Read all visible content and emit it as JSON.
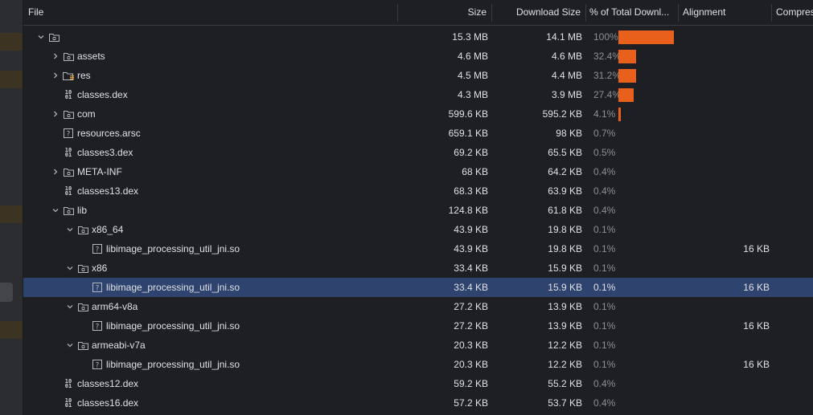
{
  "columns": {
    "file": "File",
    "size": "Size",
    "download_size": "Download Size",
    "percent": "% of Total Downl...",
    "alignment": "Alignment",
    "compression": "Compres"
  },
  "colors": {
    "accent_bar": "#e8601c",
    "selection": "#2e436e",
    "background": "#1e1f22"
  },
  "rows": [
    {
      "name": "",
      "icon": "folder-icon",
      "depth": 0,
      "chevron": "down",
      "size": "15.3 MB",
      "download": "14.1 MB",
      "percent": "100%",
      "fraction": 1.0,
      "alignment": ""
    },
    {
      "name": "assets",
      "icon": "folder-icon",
      "depth": 1,
      "chevron": "right",
      "size": "4.6 MB",
      "download": "4.6 MB",
      "percent": "32.4%",
      "fraction": 0.324,
      "alignment": ""
    },
    {
      "name": "res",
      "icon": "res-folder-icon",
      "depth": 1,
      "chevron": "right",
      "size": "4.5 MB",
      "download": "4.4 MB",
      "percent": "31.2%",
      "fraction": 0.312,
      "alignment": ""
    },
    {
      "name": "classes.dex",
      "icon": "dex-file-icon",
      "depth": 1,
      "chevron": "",
      "size": "4.3 MB",
      "download": "3.9 MB",
      "percent": "27.4%",
      "fraction": 0.274,
      "alignment": ""
    },
    {
      "name": "com",
      "icon": "folder-icon",
      "depth": 1,
      "chevron": "right",
      "size": "599.6 KB",
      "download": "595.2 KB",
      "percent": "4.1%",
      "fraction": 0.041,
      "alignment": ""
    },
    {
      "name": "resources.arsc",
      "icon": "unknown-file-icon",
      "depth": 1,
      "chevron": "",
      "size": "659.1 KB",
      "download": "98 KB",
      "percent": "0.7%",
      "fraction": 0.007,
      "alignment": ""
    },
    {
      "name": "classes3.dex",
      "icon": "dex-file-icon",
      "depth": 1,
      "chevron": "",
      "size": "69.2 KB",
      "download": "65.5 KB",
      "percent": "0.5%",
      "fraction": 0.005,
      "alignment": ""
    },
    {
      "name": "META-INF",
      "icon": "folder-icon",
      "depth": 1,
      "chevron": "right",
      "size": "68 KB",
      "download": "64.2 KB",
      "percent": "0.4%",
      "fraction": 0.004,
      "alignment": ""
    },
    {
      "name": "classes13.dex",
      "icon": "dex-file-icon",
      "depth": 1,
      "chevron": "",
      "size": "68.3 KB",
      "download": "63.9 KB",
      "percent": "0.4%",
      "fraction": 0.004,
      "alignment": ""
    },
    {
      "name": "lib",
      "icon": "folder-icon",
      "depth": 1,
      "chevron": "down",
      "size": "124.8 KB",
      "download": "61.8 KB",
      "percent": "0.4%",
      "fraction": 0.004,
      "alignment": ""
    },
    {
      "name": "x86_64",
      "icon": "folder-icon",
      "depth": 2,
      "chevron": "down",
      "size": "43.9 KB",
      "download": "19.8 KB",
      "percent": "0.1%",
      "fraction": 0.001,
      "alignment": ""
    },
    {
      "name": "libimage_processing_util_jni.so",
      "icon": "unknown-file-icon",
      "depth": 3,
      "chevron": "",
      "size": "43.9 KB",
      "download": "19.8 KB",
      "percent": "0.1%",
      "fraction": 0.001,
      "alignment": "16 KB"
    },
    {
      "name": "x86",
      "icon": "folder-icon",
      "depth": 2,
      "chevron": "down",
      "size": "33.4 KB",
      "download": "15.9 KB",
      "percent": "0.1%",
      "fraction": 0.001,
      "alignment": ""
    },
    {
      "name": "libimage_processing_util_jni.so",
      "icon": "unknown-file-icon",
      "depth": 3,
      "chevron": "",
      "size": "33.4 KB",
      "download": "15.9 KB",
      "percent": "0.1%",
      "fraction": 0.001,
      "alignment": "16 KB",
      "selected": true
    },
    {
      "name": "arm64-v8a",
      "icon": "folder-icon",
      "depth": 2,
      "chevron": "down",
      "size": "27.2 KB",
      "download": "13.9 KB",
      "percent": "0.1%",
      "fraction": 0.001,
      "alignment": ""
    },
    {
      "name": "libimage_processing_util_jni.so",
      "icon": "unknown-file-icon",
      "depth": 3,
      "chevron": "",
      "size": "27.2 KB",
      "download": "13.9 KB",
      "percent": "0.1%",
      "fraction": 0.001,
      "alignment": "16 KB"
    },
    {
      "name": "armeabi-v7a",
      "icon": "folder-icon",
      "depth": 2,
      "chevron": "down",
      "size": "20.3 KB",
      "download": "12.2 KB",
      "percent": "0.1%",
      "fraction": 0.001,
      "alignment": ""
    },
    {
      "name": "libimage_processing_util_jni.so",
      "icon": "unknown-file-icon",
      "depth": 3,
      "chevron": "",
      "size": "20.3 KB",
      "download": "12.2 KB",
      "percent": "0.1%",
      "fraction": 0.001,
      "alignment": "16 KB"
    },
    {
      "name": "classes12.dex",
      "icon": "dex-file-icon",
      "depth": 1,
      "chevron": "",
      "size": "59.2 KB",
      "download": "55.2 KB",
      "percent": "0.4%",
      "fraction": 0.004,
      "alignment": ""
    },
    {
      "name": "classes16.dex",
      "icon": "dex-file-icon",
      "depth": 1,
      "chevron": "",
      "size": "57.2 KB",
      "download": "53.7 KB",
      "percent": "0.4%",
      "fraction": 0.004,
      "alignment": ""
    }
  ]
}
